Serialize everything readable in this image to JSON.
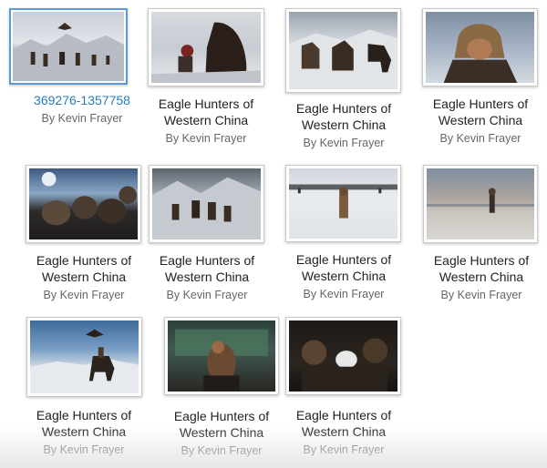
{
  "gallery": {
    "items": [
      {
        "title": "369276-1357758",
        "author": "By Kevin Frayer",
        "selected": true
      },
      {
        "title": "Eagle Hunters of Western China",
        "author": "By Kevin Frayer"
      },
      {
        "title": "Eagle Hunters of Western China",
        "author": "By Kevin Frayer"
      },
      {
        "title": "Eagle Hunters of Western China",
        "author": "By Kevin Frayer"
      },
      {
        "title": "Eagle Hunters of Western China",
        "author": "By Kevin Frayer"
      },
      {
        "title": "Eagle Hunters of Western China",
        "author": "By Kevin Frayer"
      },
      {
        "title": "Eagle Hunters of Western China",
        "author": "By Kevin Frayer"
      },
      {
        "title": "Eagle Hunters of Western China",
        "author": "By Kevin Frayer"
      },
      {
        "title": "Eagle Hunters of Western China",
        "author": "By Kevin Frayer"
      },
      {
        "title": "Eagle Hunters of Western China",
        "author": "By Kevin Frayer"
      },
      {
        "title": "Eagle Hunters of Western China",
        "author": "By Kevin Frayer"
      }
    ]
  },
  "colors": {
    "link": "#2a7ab8",
    "selection_border": "#5d9bd6",
    "title_text": "#222222",
    "author_text": "#666666"
  }
}
